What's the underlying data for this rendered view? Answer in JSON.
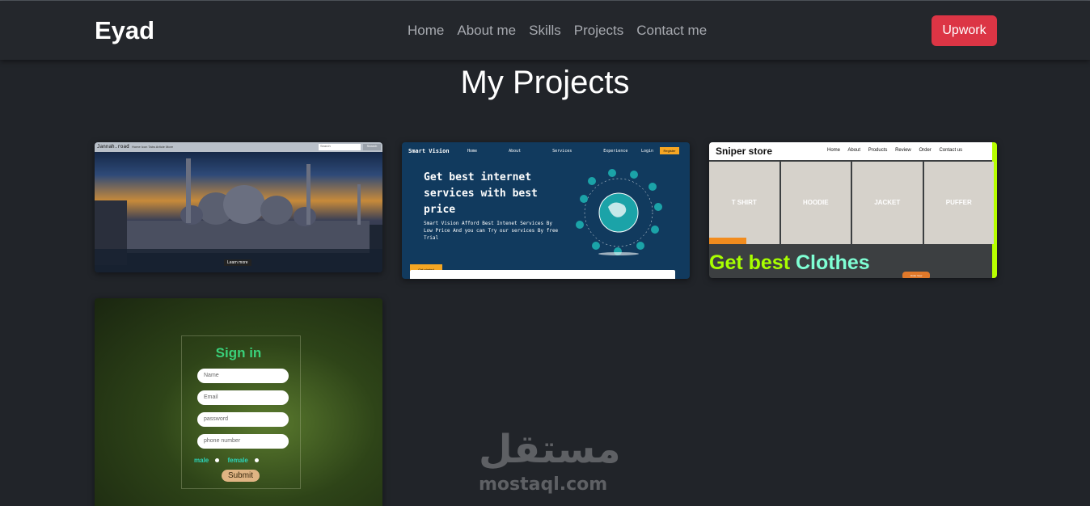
{
  "navbar": {
    "brand": "Eyad",
    "links": [
      "Home",
      "About me",
      "Skills",
      "Projects",
      "Contact me"
    ],
    "cta_label": "Upwork",
    "cta_color": "#dc3545"
  },
  "page_title": "My Projects",
  "projects": [
    {
      "name": "Jannah.road",
      "links": "Home  Icon  Tabs  Article  More",
      "search_placeholder": "Search",
      "search_button": "Search",
      "button": "Learn more"
    },
    {
      "name": "Smart Vision",
      "nav": [
        "Home",
        "About",
        "Services",
        "Experience"
      ],
      "login": "Login",
      "register": "Register",
      "headline": "Get best internet services with best price",
      "text": "Smart Vision Afford Best Intenet Services By Low Price And you can Try our services By free Trial",
      "cta": "Get started"
    },
    {
      "name": "Sniper store",
      "nav": [
        "Home",
        "About",
        "Products",
        "Review",
        "Order",
        "Contact us"
      ],
      "categories": [
        "T SHIRT",
        "HOODIE",
        "JACKET",
        "PUFFER"
      ],
      "headline_part1": "Get best",
      "headline_part2": "Clothes",
      "button": "Order Now"
    },
    {
      "title": "Sign in",
      "fields": [
        "Name",
        "Email",
        "password",
        "phone number"
      ],
      "radio_male": "male",
      "radio_female": "female",
      "submit": "Submit"
    }
  ],
  "watermark": {
    "arabic": "مستقل",
    "latin": "mostaql.com"
  }
}
